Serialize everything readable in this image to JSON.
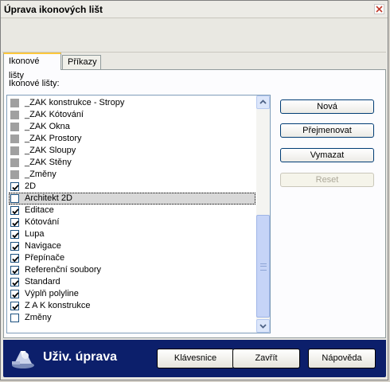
{
  "window": {
    "title": "Úprava ikonových lišt"
  },
  "tabs": [
    {
      "label": "Ikonové lišty",
      "active": true
    },
    {
      "label": "Příkazy",
      "active": false
    }
  ],
  "panel": {
    "label": "Ikonové lišty:"
  },
  "toolbars": [
    {
      "label": "_ZAK konstrukce - Stropy",
      "state": "indeterminate"
    },
    {
      "label": "_ZAK Kótování",
      "state": "indeterminate"
    },
    {
      "label": "_ZAK Okna",
      "state": "indeterminate"
    },
    {
      "label": "_ZAK Prostory",
      "state": "indeterminate"
    },
    {
      "label": "_ZAK Sloupy",
      "state": "indeterminate"
    },
    {
      "label": "_ZAK Stěny",
      "state": "indeterminate"
    },
    {
      "label": "_Změny",
      "state": "indeterminate"
    },
    {
      "label": "2D",
      "state": "checked"
    },
    {
      "label": "Architekt 2D",
      "state": "unchecked",
      "selected": true
    },
    {
      "label": "Editace",
      "state": "checked"
    },
    {
      "label": "Kótování",
      "state": "checked"
    },
    {
      "label": "Lupa",
      "state": "checked"
    },
    {
      "label": "Navigace",
      "state": "checked"
    },
    {
      "label": "Přepínače",
      "state": "checked"
    },
    {
      "label": "Referenční soubory",
      "state": "checked"
    },
    {
      "label": "Standard",
      "state": "checked"
    },
    {
      "label": "Výplň polyline",
      "state": "checked"
    },
    {
      "label": "Z A K konstrukce",
      "state": "checked"
    },
    {
      "label": "Změny",
      "state": "unchecked"
    }
  ],
  "actions": {
    "new": "Nová",
    "rename": "Přejmenovat",
    "delete": "Vymazat",
    "reset": "Reset"
  },
  "footer": {
    "title": "Uživ. úprava",
    "keyboard": "Klávesnice",
    "close": "Zavřít",
    "help": "Nápověda"
  },
  "colors": {
    "footer_bg": "#0c1f6b",
    "tab_accent": "#ffc83c",
    "selected_row": "#d8d8d8"
  }
}
